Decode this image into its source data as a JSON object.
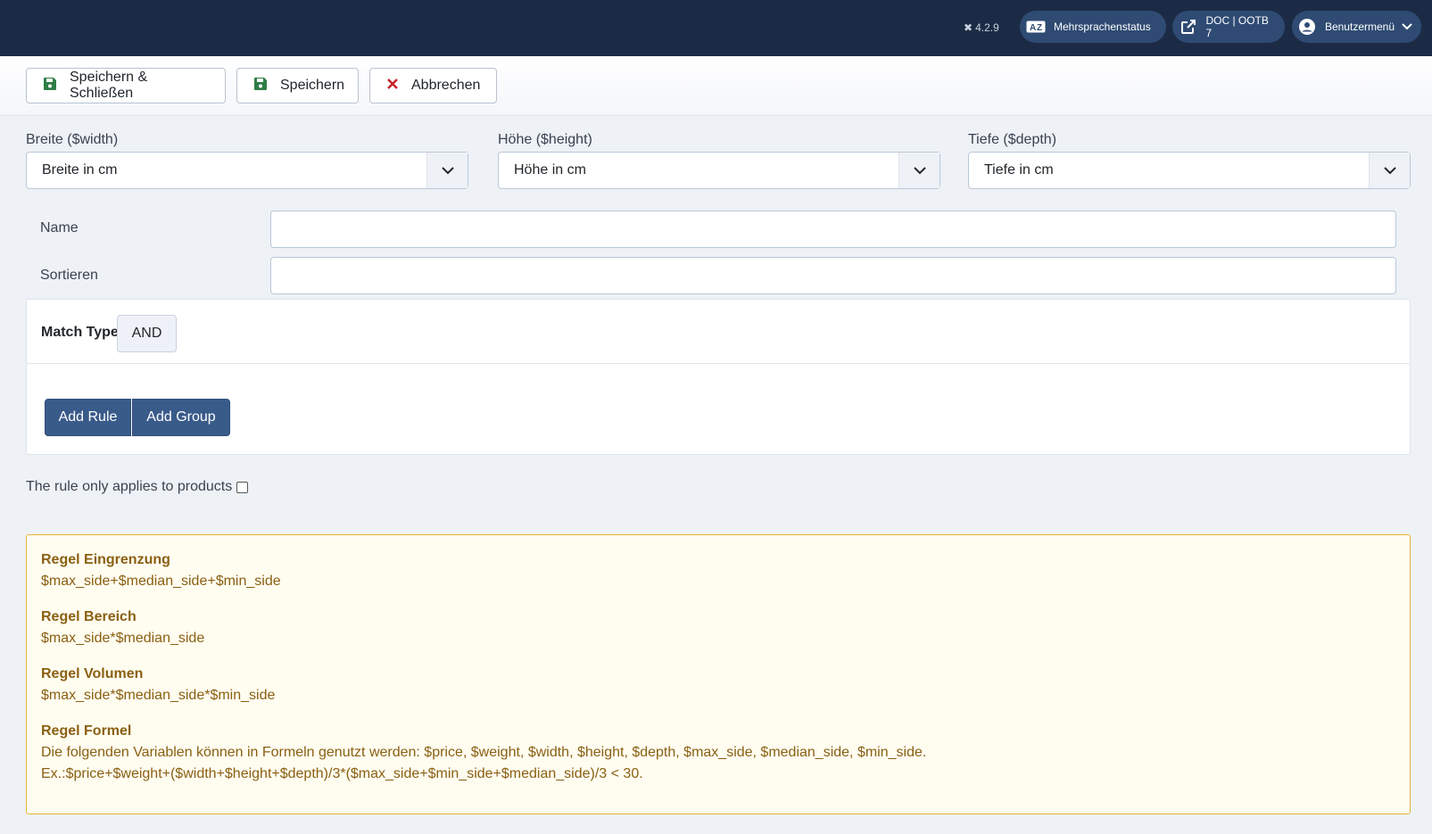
{
  "header": {
    "version": "4.2.9",
    "language_status": "Mehrsprachenstatus",
    "doc_link": "DOC | OOTB 7",
    "user_menu": "Benutzermenü"
  },
  "toolbar": {
    "save_close": "Speichern & Schließen",
    "save": "Speichern",
    "cancel": "Abbrechen"
  },
  "dimensions": {
    "width": {
      "label": "Breite ($width)",
      "value": "Breite in cm"
    },
    "height": {
      "label": "Höhe ($height)",
      "value": "Höhe in cm"
    },
    "depth": {
      "label": "Tiefe ($depth)",
      "value": "Tiefe in cm"
    }
  },
  "form": {
    "name_label": "Name",
    "name_value": "",
    "sort_label": "Sortieren",
    "sort_value": ""
  },
  "rule_builder": {
    "match_type_label": "Match Type",
    "match_type_value": "AND",
    "add_rule": "Add Rule",
    "add_group": "Add Group"
  },
  "products_only_label": "The rule only applies to products",
  "info": {
    "sections": [
      {
        "title": "Regel Eingrenzung",
        "lines": [
          "$max_side+$median_side+$min_side"
        ]
      },
      {
        "title": "Regel Bereich",
        "lines": [
          "$max_side*$median_side"
        ]
      },
      {
        "title": "Regel Volumen",
        "lines": [
          "$max_side*$median_side*$min_side"
        ]
      },
      {
        "title": "Regel Formel",
        "lines": [
          "Die folgenden Variablen können in Formeln genutzt werden: $price, $weight, $width, $height, $depth, $max_side, $median_side, $min_side.",
          "Ex.:$price+$weight+($width+$height+$depth)/3*($max_side+$min_side+$median_side)/3 < 30."
        ]
      }
    ]
  },
  "colors": {
    "header_bg": "#1c2b45",
    "pill_bg": "#2f4b73",
    "primary_button": "#395b8a",
    "info_border": "#e5b53a",
    "info_text": "#8a6012",
    "save_icon": "#2e7d46",
    "cancel_icon": "#c8252c"
  }
}
